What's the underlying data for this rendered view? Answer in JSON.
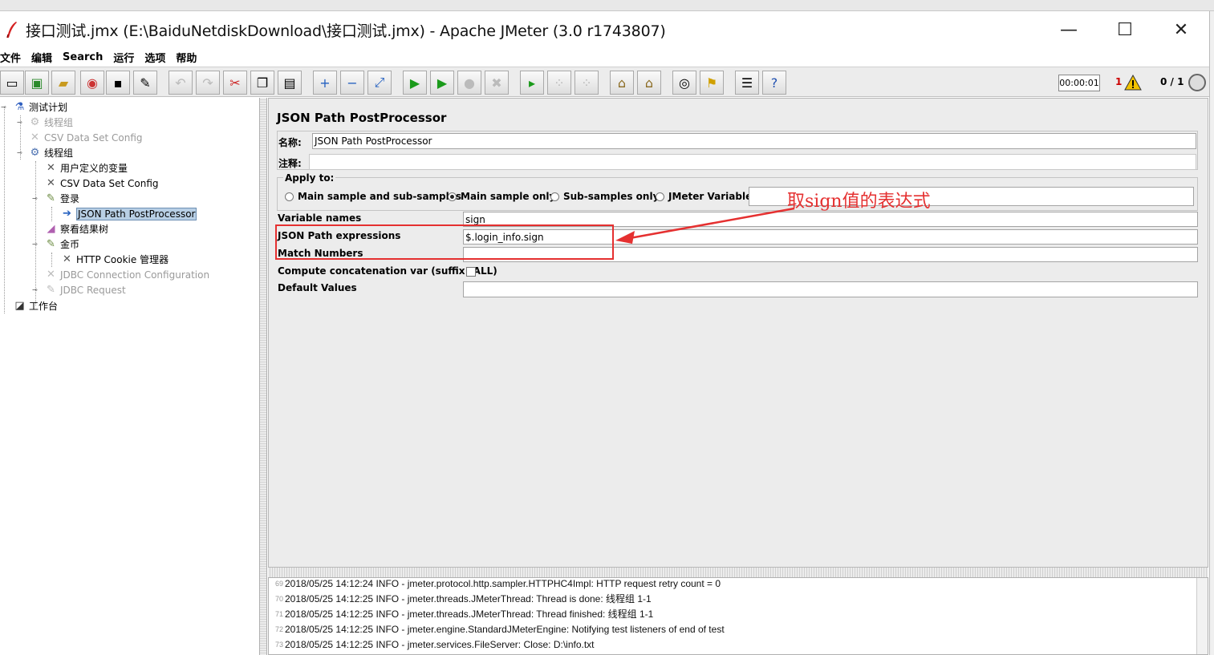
{
  "window": {
    "title": "接口测试.jmx (E:\\BaiduNetdiskDownload\\接口测试.jmx) - Apache JMeter (3.0 r1743807)",
    "minimize": "—",
    "maximize": "☐",
    "close": "✕"
  },
  "menu": [
    "文件",
    "编辑",
    "Search",
    "运行",
    "选项",
    "帮助"
  ],
  "toolbar": {
    "timer": "00:00:01",
    "warning_count": "1",
    "threads": "0 / 1"
  },
  "tree": {
    "nodes": [
      {
        "label": "测试计划",
        "icon": "flask-icon",
        "disabled": false,
        "selected": false
      },
      {
        "label": "线程组",
        "icon": "gear-icon",
        "disabled": true,
        "selected": false
      },
      {
        "label": "CSV Data Set Config",
        "icon": "tools-icon",
        "disabled": true,
        "selected": false
      },
      {
        "label": "线程组",
        "icon": "gear-icon",
        "disabled": false,
        "selected": false
      },
      {
        "label": "用户定义的变量",
        "icon": "tools-icon",
        "disabled": false,
        "selected": false
      },
      {
        "label": "CSV Data Set Config",
        "icon": "tools-icon",
        "disabled": false,
        "selected": false
      },
      {
        "label": "登录",
        "icon": "pen-icon",
        "disabled": false,
        "selected": false
      },
      {
        "label": "JSON Path PostProcessor",
        "icon": "arrow-icon",
        "disabled": false,
        "selected": true
      },
      {
        "label": "察看结果树",
        "icon": "chart-icon",
        "disabled": false,
        "selected": false
      },
      {
        "label": "金币",
        "icon": "pen-icon",
        "disabled": false,
        "selected": false
      },
      {
        "label": "HTTP Cookie 管理器",
        "icon": "tools-icon",
        "disabled": false,
        "selected": false
      },
      {
        "label": "JDBC Connection Configuration",
        "icon": "tools-icon",
        "disabled": true,
        "selected": false
      },
      {
        "label": "JDBC Request",
        "icon": "pen-icon",
        "disabled": true,
        "selected": false
      },
      {
        "label": "工作台",
        "icon": "workbench-icon",
        "disabled": false,
        "selected": false
      }
    ]
  },
  "panel": {
    "title": "JSON Path PostProcessor",
    "name_label": "名称:",
    "name_value": "JSON Path PostProcessor",
    "comment_label": "注释:",
    "comment_value": "",
    "apply_to_label": "Apply to:",
    "apply_options": [
      {
        "label": "Main sample and sub-samples",
        "checked": false
      },
      {
        "label": "Main sample only",
        "checked": true
      },
      {
        "label": "Sub-samples only",
        "checked": false
      },
      {
        "label": "JMeter Variable",
        "checked": false
      }
    ],
    "jmeter_variable_value": "",
    "variable_names_label": "Variable names",
    "variable_names_value": "sign",
    "json_path_label": "JSON Path expressions",
    "json_path_value": "$.login_info.sign",
    "match_numbers_label": "Match Numbers",
    "match_numbers_value": "",
    "compute_concat_label": "Compute concatenation var (suffix _ALL)",
    "compute_concat_checked": false,
    "default_values_label": "Default Values",
    "default_values_value": ""
  },
  "annotation": {
    "text": "取sign值的表达式",
    "color": "#e53030"
  },
  "log": {
    "lines": [
      {
        "n": "69",
        "text": "2018/05/25 14:12:24 INFO  - jmeter.protocol.http.sampler.HTTPHC4Impl: HTTP request retry count = 0"
      },
      {
        "n": "70",
        "text": "2018/05/25 14:12:25 INFO  - jmeter.threads.JMeterThread: Thread is done: 线程组 1-1"
      },
      {
        "n": "71",
        "text": "2018/05/25 14:12:25 INFO  - jmeter.threads.JMeterThread: Thread finished: 线程组 1-1"
      },
      {
        "n": "72",
        "text": "2018/05/25 14:12:25 INFO  - jmeter.engine.StandardJMeterEngine: Notifying test listeners of end of test"
      },
      {
        "n": "73",
        "text": "2018/05/25 14:12:25 INFO  - jmeter.services.FileServer: Close: D:\\info.txt"
      }
    ]
  }
}
